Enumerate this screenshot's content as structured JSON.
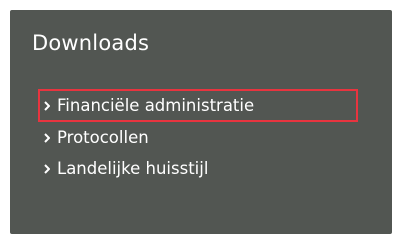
{
  "panel": {
    "title": "Downloads",
    "background": "#525652",
    "highlight_color": "#e8343f"
  },
  "menu": {
    "items": [
      {
        "label": "Financiële administratie",
        "icon": "chevron-right-icon",
        "highlighted": true
      },
      {
        "label": "Protocollen",
        "icon": "chevron-right-icon",
        "highlighted": false
      },
      {
        "label": "Landelijke huisstijl",
        "icon": "chevron-right-icon",
        "highlighted": false
      }
    ]
  }
}
